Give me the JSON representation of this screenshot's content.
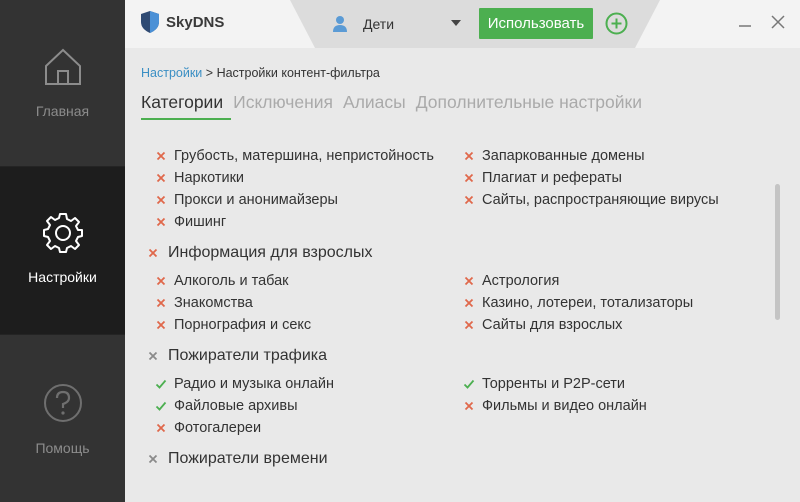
{
  "sidebar": {
    "items": [
      {
        "label": "Главная",
        "icon": "home-icon"
      },
      {
        "label": "Настройки",
        "icon": "gear-icon",
        "active": true
      },
      {
        "label": "Помощь",
        "icon": "question-icon"
      }
    ]
  },
  "header": {
    "brand": "SkyDNS",
    "profile_name": "Дети",
    "use_button": "Использовать"
  },
  "breadcrumb": {
    "link": "Настройки",
    "separator": ">",
    "current": "Настройки контент-фильтра"
  },
  "tabs": [
    {
      "label": "Категории",
      "active": true
    },
    {
      "label": "Исключения"
    },
    {
      "label": "Алиасы"
    },
    {
      "label": "Дополнительные настройки"
    }
  ],
  "colors": {
    "accent": "#4caf50",
    "blocked": "#e0684b",
    "allowed": "#4caf50",
    "link": "#3b8fc4"
  },
  "categories": {
    "top_left": [
      {
        "label": "Грубость, матершина, непристойность",
        "status": "blocked"
      },
      {
        "label": "Наркотики",
        "status": "blocked"
      },
      {
        "label": "Прокси и анонимайзеры",
        "status": "blocked"
      },
      {
        "label": "Фишинг",
        "status": "blocked"
      }
    ],
    "top_right": [
      {
        "label": "Запаркованные домены",
        "status": "blocked"
      },
      {
        "label": "Плагиат и рефераты",
        "status": "blocked"
      },
      {
        "label": "Сайты, распространяющие вирусы",
        "status": "blocked"
      }
    ],
    "groups": [
      {
        "title": "Информация для взрослых",
        "status": "blocked",
        "left": [
          {
            "label": "Алкоголь и табак",
            "status": "blocked"
          },
          {
            "label": "Знакомства",
            "status": "blocked"
          },
          {
            "label": "Порнография и секс",
            "status": "blocked"
          }
        ],
        "right": [
          {
            "label": "Астрология",
            "status": "blocked"
          },
          {
            "label": "Казино, лотереи, тотализаторы",
            "status": "blocked"
          },
          {
            "label": "Сайты для взрослых",
            "status": "blocked"
          }
        ]
      },
      {
        "title": "Пожиратели трафика",
        "status": "partial",
        "left": [
          {
            "label": "Радио и музыка онлайн",
            "status": "allowed"
          },
          {
            "label": "Файловые архивы",
            "status": "allowed"
          },
          {
            "label": "Фотогалереи",
            "status": "blocked"
          }
        ],
        "right": [
          {
            "label": "Торренты и P2P-сети",
            "status": "allowed"
          },
          {
            "label": "Фильмы и видео онлайн",
            "status": "blocked"
          }
        ]
      },
      {
        "title": "Пожиратели времени",
        "status": "partial",
        "left": [],
        "right": []
      }
    ]
  }
}
